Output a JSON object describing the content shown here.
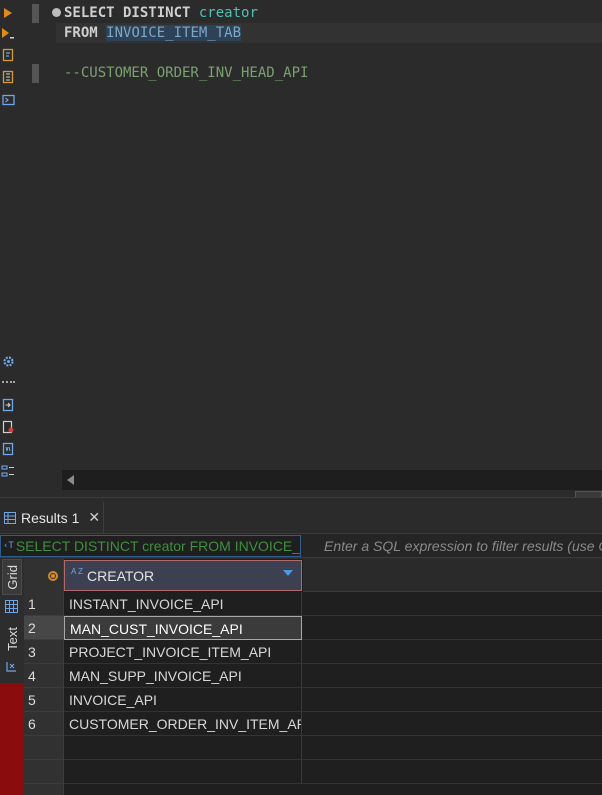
{
  "editor": {
    "line1": {
      "kw1": "SELECT DISTINCT",
      "ident": "creator"
    },
    "line2": {
      "kw": "FROM",
      "table": "INVOICE_ITEM_TAB"
    },
    "line4": {
      "comment": "--CUSTOMER_ORDER_INV_HEAD_API"
    }
  },
  "gutter_icons": [
    "run-statement-icon",
    "run-script-icon",
    "explain-plan-icon",
    "load-script-icon",
    "terminal-icon",
    "settings-icon",
    "more-icon",
    "export-icon",
    "error-log-icon",
    "variables-icon",
    "outline-icon"
  ],
  "results": {
    "tab_label": "Results 1",
    "close_glyph": "✕",
    "query_text": "SELECT DISTINCT creator FROM INVOICE_",
    "query_icon": "‹T",
    "filter_placeholder": "Enter a SQL expression to filter results (use C",
    "side_tabs": {
      "grid": "Grid",
      "text": "Text"
    },
    "column": {
      "az": "A Z",
      "name": "CREATOR"
    },
    "rows": [
      {
        "num": "1",
        "value": "INSTANT_INVOICE_API"
      },
      {
        "num": "2",
        "value": "MAN_CUST_INVOICE_API"
      },
      {
        "num": "3",
        "value": "PROJECT_INVOICE_ITEM_API"
      },
      {
        "num": "4",
        "value": "MAN_SUPP_INVOICE_API"
      },
      {
        "num": "5",
        "value": "INVOICE_API"
      },
      {
        "num": "6",
        "value": "CUSTOMER_ORDER_INV_ITEM_API"
      }
    ],
    "selected_row": "2"
  },
  "colors": {
    "accent": "#4a9ae0",
    "run": "#e08a1e",
    "error_strip": "#8b0c0c"
  }
}
